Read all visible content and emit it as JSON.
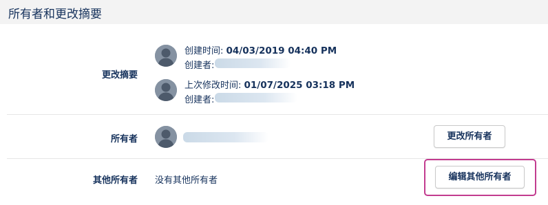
{
  "header": {
    "title": "所有者和更改摘要"
  },
  "summary": {
    "label": "更改摘要",
    "created": {
      "time_label": "创建时间: ",
      "time_value": "04/03/2019 04:40 PM",
      "by_label": "创建者:"
    },
    "modified": {
      "time_label": "上次修改时间: ",
      "time_value": "01/07/2025 03:18 PM",
      "by_label": "创建者:"
    }
  },
  "owner": {
    "label": "所有者",
    "change_button": "更改所有者"
  },
  "other_owners": {
    "label": "其他所有者",
    "value": "没有其他所有者",
    "edit_button": "编辑其他所有者"
  },
  "colors": {
    "text": "#16325c",
    "header_bg": "#f3f3f3",
    "highlight": "#c23b8f",
    "avatar": "#8592a2"
  }
}
